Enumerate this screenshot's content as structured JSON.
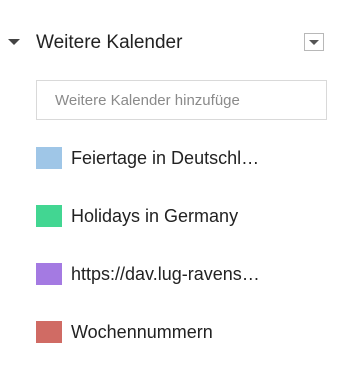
{
  "section": {
    "title": "Weitere Kalender",
    "collapse_icon": "caret-down-icon",
    "menu_icon": "dropdown-menu-icon"
  },
  "add_calendar": {
    "placeholder": "Weitere Kalender hinzufüge",
    "value": ""
  },
  "calendars": [
    {
      "label": "Feiertage in Deutschl…",
      "color": "#9fc6e7"
    },
    {
      "label": "Holidays in Germany",
      "color": "#42d692"
    },
    {
      "label": "https://dav.lug-ravens…",
      "color": "#a47ae2"
    },
    {
      "label": "Wochennummern",
      "color": "#d06b64"
    }
  ]
}
